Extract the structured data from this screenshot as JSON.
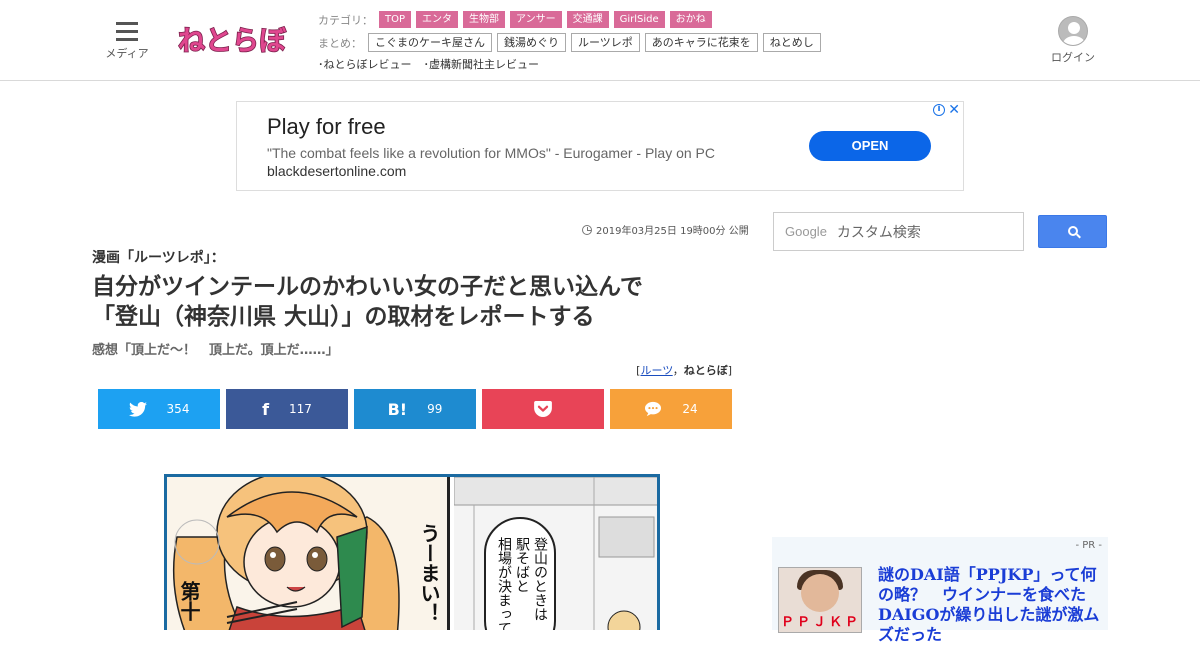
{
  "header": {
    "menu_label": "メディア",
    "logo_text": "ねとらぼ",
    "category_label": "カテゴリ：",
    "categories": [
      "TOP",
      "エンタ",
      "生物部",
      "アンサー",
      "交通課",
      "GirlSide",
      "おかね"
    ],
    "matome_label": "まとめ：",
    "matome": [
      "こぐまのケーキ屋さん",
      "銭湯めぐり",
      "ルーツレポ",
      "あのキャラに花束を",
      "ねとめし"
    ],
    "reviews": [
      "･ねとらぼレビュー",
      "･虚構新聞社主レビュー"
    ],
    "login_label": "ログイン"
  },
  "ad": {
    "headline": "Play for free",
    "description": "\"The combat feels like a revolution for MMOs\" - Eurogamer - Play on PC",
    "url": "blackdesertonline.com",
    "button": "OPEN"
  },
  "article": {
    "published": "2019年03月25日 19時00分 公開",
    "series": "漫画「ルーツレポ」：",
    "title_line1": "自分がツインテールのかわいい女の子だと思い込んで",
    "title_line2": "「登山（神奈川県 大山）」の取材をレポートする",
    "subtitle": "感想「頂上だ～！　頂上だ。頂上だ……」",
    "credit_open": "[",
    "credit_author": "ルーツ",
    "credit_sep": "，",
    "credit_site": "ねとらぼ",
    "credit_close": "]"
  },
  "share": {
    "twitter": "354",
    "facebook": "117",
    "hatena_icon": "B!",
    "hatena": "99",
    "comments": "24"
  },
  "manga": {
    "exclaim": "うーまい！",
    "side_text": "第十",
    "bubble_line1": "登山のときは",
    "bubble_line2": "駅そばと",
    "bubble_line3": "相場が決まって"
  },
  "sidebar": {
    "search_brand": "Google",
    "search_placeholder": "カスタム検索",
    "pr_label": "- PR -",
    "pr_thumb_caption": "ＰＰＪＫＰ",
    "pr_title": "謎のDAI語「PPJKP」って何の略？　ウインナーを食べたDAIGOが繰り出した謎が激ムズだった"
  },
  "colors": {
    "category_tag": "#d96a98",
    "twitter": "#1da1f2",
    "facebook": "#3b5998",
    "hatena": "#1e8bd0",
    "pocket": "#e84457",
    "comment": "#f7a13a",
    "ad_button": "#0b66e8",
    "pr_link": "#1a3dd6"
  }
}
